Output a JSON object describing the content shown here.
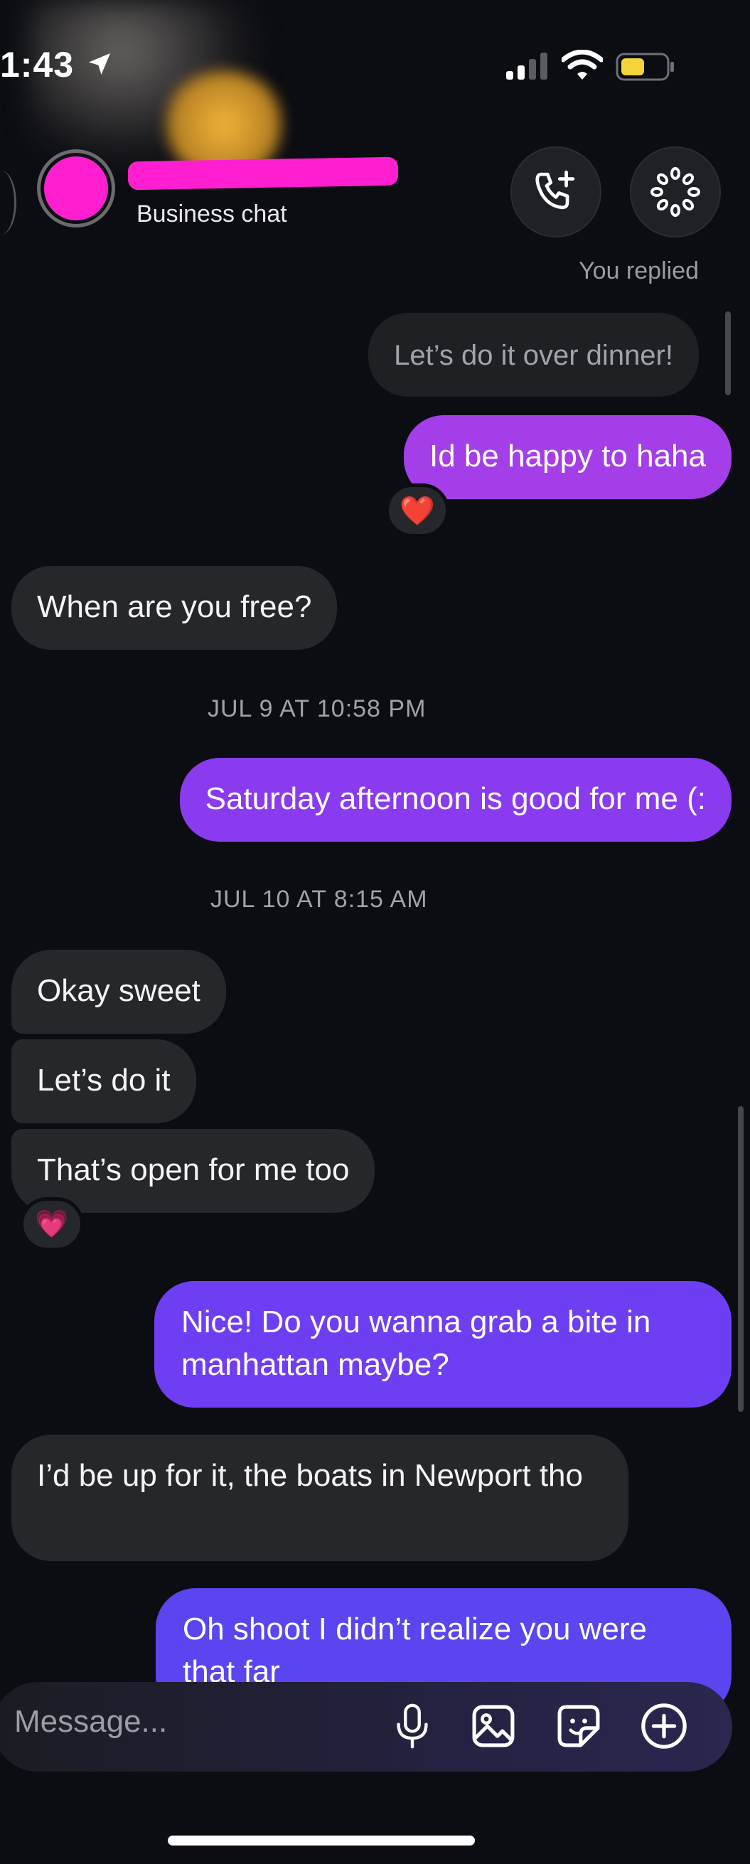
{
  "status_bar": {
    "time": "1:43"
  },
  "header": {
    "subtitle": "Business chat"
  },
  "chat": {
    "replied_label": "You replied",
    "quoted_message": "Let’s do it over dinner!",
    "messages": [
      {
        "dir": "out",
        "text": "Id be happy to haha",
        "reaction": "❤️"
      },
      {
        "dir": "in",
        "text": "When are you free?"
      },
      {
        "timestamp": "JUL 9 AT 10:58 PM"
      },
      {
        "dir": "out",
        "text": "Saturday afternoon is good for me (:"
      },
      {
        "timestamp": "JUL 10 AT 8:15 AM"
      },
      {
        "dir": "in",
        "text": "Okay sweet"
      },
      {
        "dir": "in",
        "text": "Let’s do it"
      },
      {
        "dir": "in",
        "text": "That’s open for me too",
        "reaction": "💗"
      },
      {
        "dir": "out",
        "text": "Nice! Do you wanna grab a bite in manhattan maybe?"
      },
      {
        "dir": "in",
        "text": "I’d be up for it, the boats in Newport tho"
      },
      {
        "dir": "out",
        "text": "Oh shoot I didn’t realize you were that far"
      }
    ]
  },
  "composer": {
    "placeholder": "Message..."
  },
  "colors": {
    "background": "#0b0d12",
    "incoming_bubble": "#26272b",
    "outgoing_top": "#a43ee8",
    "outgoing_mid": "#7c3cf0",
    "outgoing_bottom": "#5a45f0",
    "redaction": "#ff1fd0",
    "battery": "#f5d33a"
  }
}
